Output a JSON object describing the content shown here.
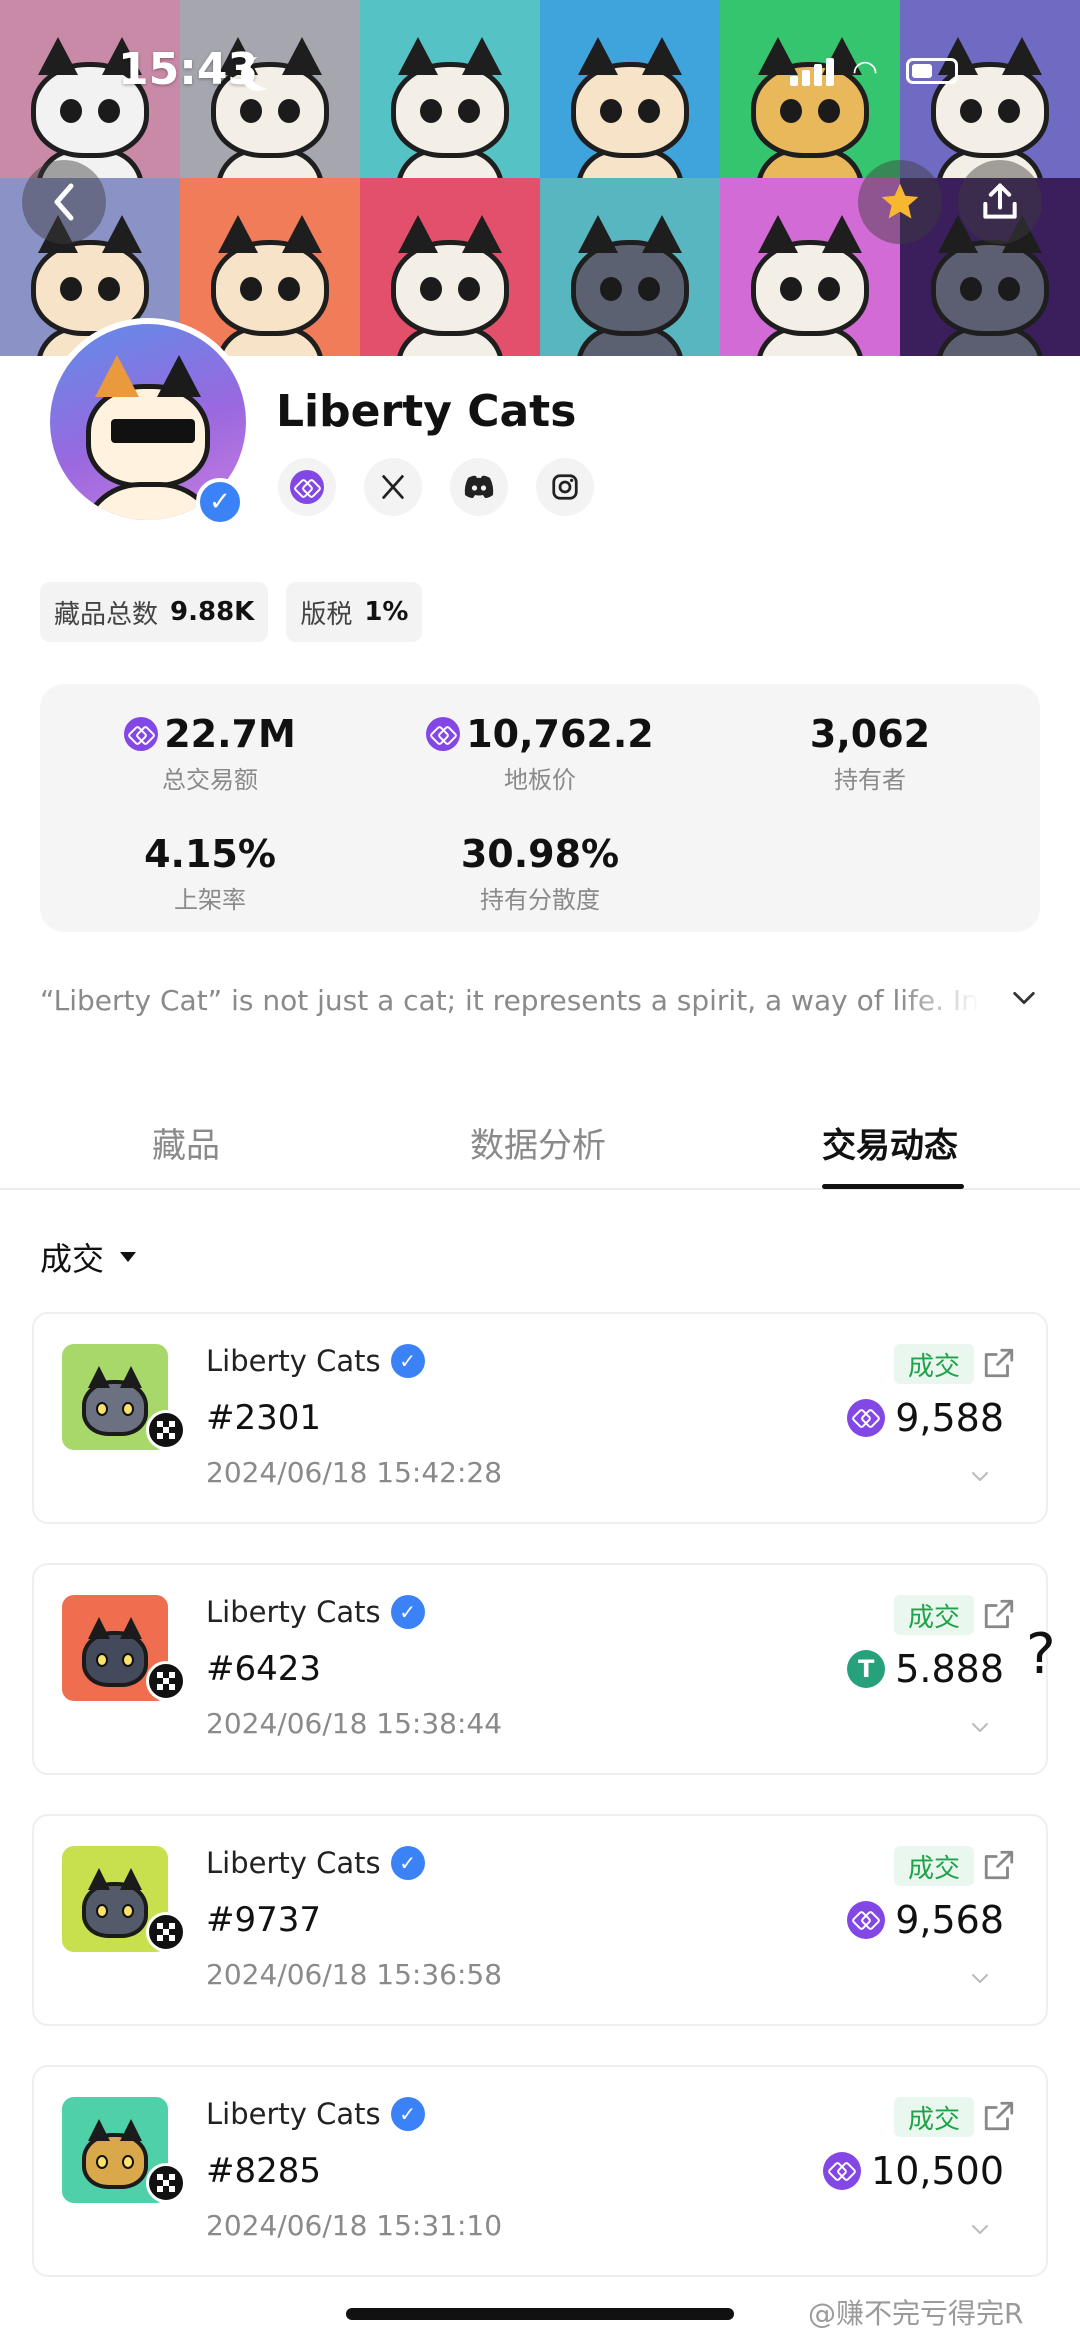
{
  "status_bar": {
    "time": "15:43"
  },
  "banner": {
    "tiles": [
      {
        "bg": "#c98aa8",
        "cat": "#f2f2f2"
      },
      {
        "bg": "#a5a6ae",
        "cat": "#f4efe6"
      },
      {
        "bg": "#55c2c6",
        "cat": "#f4efe6"
      },
      {
        "bg": "#3fa4dc",
        "cat": "#f7e3c7"
      },
      {
        "bg": "#35c56e",
        "cat": "#e8b85a"
      },
      {
        "bg": "#6f6ac2",
        "cat": "#f4efe6"
      },
      {
        "bg": "#8b93c6",
        "cat": "#f7e3c7"
      },
      {
        "bg": "#f07c5a",
        "cat": "#f7e3c7"
      },
      {
        "bg": "#e3506b",
        "cat": "#f4efe6"
      },
      {
        "bg": "#57b6c0",
        "cat": "#5b6170"
      },
      {
        "bg": "#d26bd6",
        "cat": "#f4efe6"
      },
      {
        "bg": "#3b1f5c",
        "cat": "#5c5f72"
      }
    ]
  },
  "profile": {
    "name": "Liberty Cats",
    "socials": [
      "polygon-icon",
      "x-icon",
      "discord-icon",
      "instagram-icon"
    ]
  },
  "chips": [
    {
      "label": "藏品总数",
      "value": "9.88K"
    },
    {
      "label": "版税",
      "value": "1%"
    }
  ],
  "stats": [
    {
      "value": "22.7M",
      "label": "总交易额",
      "currency": "polygon"
    },
    {
      "value": "10,762.2",
      "label": "地板价",
      "currency": "polygon"
    },
    {
      "value": "3,062",
      "label": "持有者",
      "currency": ""
    },
    {
      "value": "4.15%",
      "label": "上架率",
      "currency": ""
    },
    {
      "value": "30.98%",
      "label": "持有分散度",
      "currency": ""
    }
  ],
  "description": "“Liberty Cat” is not just a cat; it represents a spirit, a way of life. In th",
  "tabs": [
    "藏品",
    "数据分析",
    "交易动态"
  ],
  "active_tab": "交易动态",
  "filter": {
    "label": "成交"
  },
  "trades": [
    {
      "collection": "Liberty Cats",
      "token": "#2301",
      "time": "2024/06/18 15:42:28",
      "status": "成交",
      "price": "9,588",
      "currency": "polygon",
      "thumb_bg": "#a8d86a",
      "thumb_cat": "#6b7180"
    },
    {
      "collection": "Liberty Cats",
      "token": "#6423",
      "time": "2024/06/18 15:38:44",
      "status": "成交",
      "price": "5.888",
      "currency": "usdt",
      "thumb_bg": "#ee6e4f",
      "thumb_cat": "#434a5c"
    },
    {
      "collection": "Liberty Cats",
      "token": "#9737",
      "time": "2024/06/18 15:36:58",
      "status": "成交",
      "price": "9,568",
      "currency": "polygon",
      "thumb_bg": "#c8e04e",
      "thumb_cat": "#535a6a"
    },
    {
      "collection": "Liberty Cats",
      "token": "#8285",
      "time": "2024/06/18 15:31:10",
      "status": "成交",
      "price": "10,500",
      "currency": "polygon",
      "thumb_bg": "#4fd0a8",
      "thumb_cat": "#d9a84a"
    }
  ],
  "annotation": "?",
  "watermark": "@赚不完亏得完R",
  "colors": {
    "accent": "#8247e5",
    "verified": "#3b82f6",
    "success": "#1fa34a",
    "usdt": "#26a17b"
  }
}
